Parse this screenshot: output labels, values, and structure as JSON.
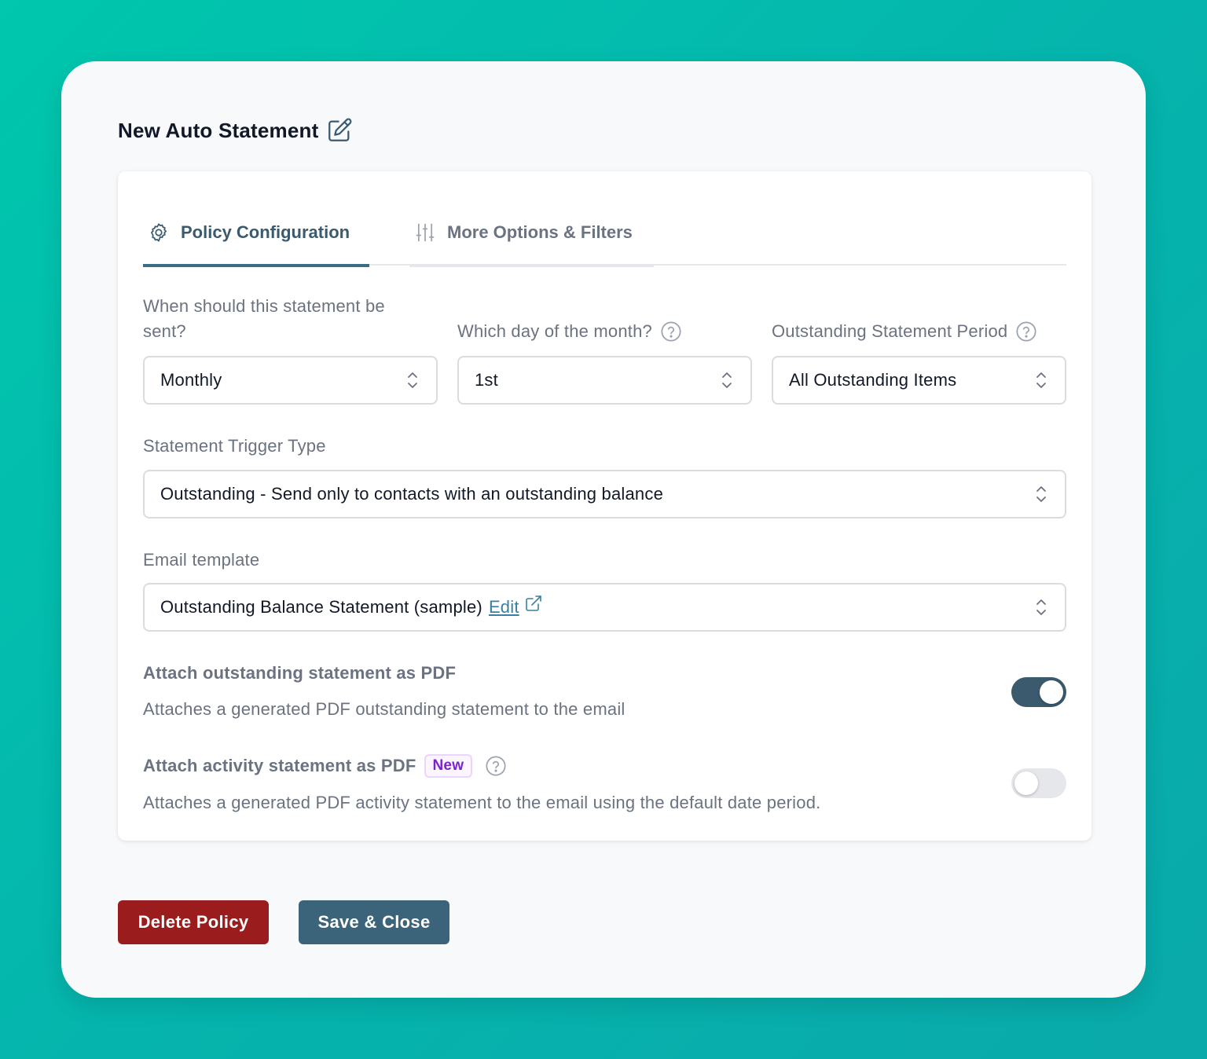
{
  "header": {
    "title": "New Auto Statement",
    "edit_icon": "pencil-square-icon"
  },
  "tabs": [
    {
      "label": "Policy Configuration",
      "icon": "gear-icon",
      "active": true
    },
    {
      "label": "More Options & Filters",
      "icon": "sliders-icon",
      "active": false
    }
  ],
  "fields": {
    "frequency": {
      "label": "When should this statement be sent?",
      "value": "Monthly"
    },
    "day_of_month": {
      "label": "Which day of the month?",
      "value": "1st"
    },
    "period": {
      "label": "Outstanding Statement Period",
      "value": "All Outstanding Items"
    },
    "trigger": {
      "label": "Statement Trigger Type",
      "value": "Outstanding - Send only to contacts with an outstanding balance"
    },
    "template": {
      "label": "Email template",
      "value": "Outstanding Balance Statement (sample)",
      "edit_link": "Edit"
    }
  },
  "attach_outstanding": {
    "title": "Attach outstanding statement as PDF",
    "description": "Attaches a generated PDF outstanding statement to the email",
    "enabled": true
  },
  "attach_activity": {
    "title": "Attach activity statement as PDF",
    "badge": "New",
    "description": "Attaches a generated PDF activity statement to the email using the default date period.",
    "enabled": false
  },
  "actions": {
    "delete_label": "Delete Policy",
    "save_label": "Save & Close"
  },
  "colors": {
    "background": "#00c0ad",
    "primary": "#3b5a6e",
    "danger": "#9b1c1c",
    "badge": "#7e22ce"
  }
}
